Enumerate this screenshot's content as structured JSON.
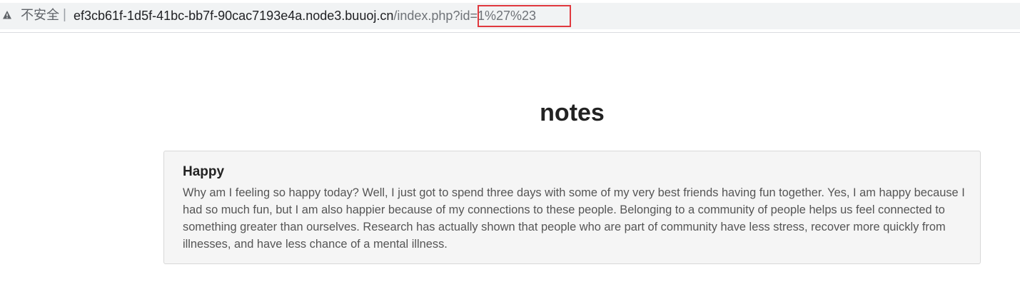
{
  "browser": {
    "security_label": "不安全",
    "separator": "|",
    "url": {
      "host": "ef3cb61f-1d5f-41bc-bb7f-90cac7193e4a.node3.buuoj.cn",
      "path": "/index.php",
      "query": "?id=1%27%23"
    },
    "highlight_color": "#e0393e"
  },
  "page": {
    "title": "notes",
    "notes": [
      {
        "title": "Happy",
        "body": "Why am I feeling so happy today? Well, I just got to spend three days with some of my very best friends having fun together. Yes, I am happy because I had so much fun, but I am also happier because of my connections to these people. Belonging to a community of people helps us feel connected to something greater than ourselves. Research has actually shown that people who are part of community have less stress, recover more quickly from illnesses, and have less chance of a mental illness."
      }
    ]
  }
}
